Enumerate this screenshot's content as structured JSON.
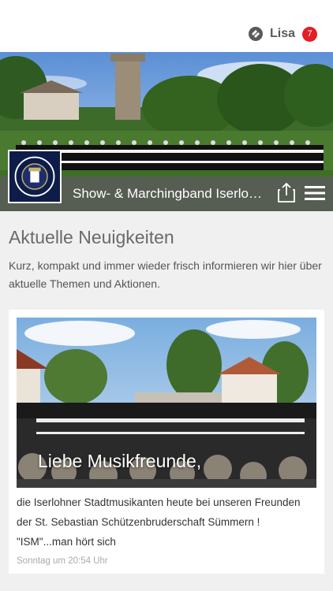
{
  "header": {
    "username": "Lisa",
    "notification_count": "7",
    "brand_icon": "app-logo-icon"
  },
  "hero": {
    "band_title": "Show- & Marchingband Iserlo…",
    "crest_icon": "band-crest-icon",
    "share_icon": "share-icon",
    "menu_icon": "hamburger-menu-icon"
  },
  "main": {
    "title": "Aktuelle Neuigkeiten",
    "intro": "Kurz, kompakt und immer wieder frisch informieren wir hier über aktuelle Themen und Aktionen."
  },
  "post": {
    "caption": "Liebe Musikfreunde,",
    "text_lines": [
      "die Iserlohner Stadtmusikanten heute bei unseren Freunden",
      "der St. Sebastian Schützenbruderschaft Sümmern !",
      "\"ISM\"...man hört sich"
    ],
    "timestamp": "Sonntag um 20:54 Uhr"
  },
  "colors": {
    "accent": "#e31e24",
    "title_bar": "#5a5a5a",
    "background": "#f0f0f0"
  }
}
